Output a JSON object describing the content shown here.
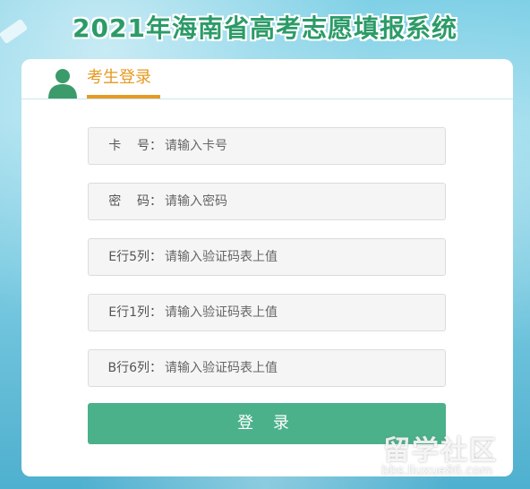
{
  "header": {
    "title": "2021年海南省高考志愿填报系统"
  },
  "login_card": {
    "tab_label": "考生登录",
    "avatar_icon": "user-avatar-icon",
    "fields": [
      {
        "label": "卡    号：",
        "placeholder": "请输入卡号",
        "value": ""
      },
      {
        "label": "密    码：",
        "placeholder": "请输入密码",
        "value": ""
      },
      {
        "label": "E行5列：",
        "placeholder": "请输入验证码表上值",
        "value": ""
      },
      {
        "label": "E行1列：",
        "placeholder": "请输入验证码表上值",
        "value": ""
      },
      {
        "label": "B行6列：",
        "placeholder": "请输入验证码表上值",
        "value": ""
      }
    ],
    "submit_label": "登 录"
  },
  "watermark": {
    "text": "留学社区",
    "url": "bbs.liuxue86.com"
  },
  "colors": {
    "title_green": "#2c9b68",
    "tab_orange": "#e69a22",
    "button_green": "#4bb18a",
    "avatar_green": "#3c9b6a"
  }
}
